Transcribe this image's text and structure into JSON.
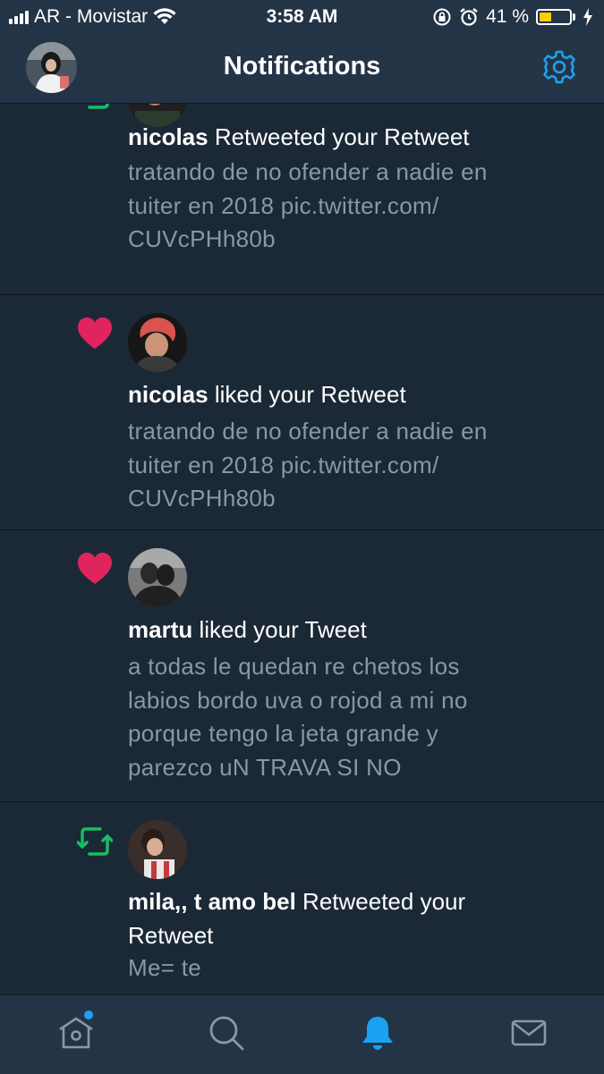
{
  "status_bar": {
    "carrier": "AR - Movistar",
    "time": "3:58 AM",
    "battery_percent": "41 %",
    "battery_level": 0.41,
    "battery_color": "#ffcc00"
  },
  "header": {
    "title": "Notifications"
  },
  "colors": {
    "accent": "#1da1f2",
    "like": "#e0245e",
    "retweet": "#17bf63",
    "background": "#1b2836",
    "bar": "#243447",
    "secondary_text": "#8899a6"
  },
  "notifications": [
    {
      "type": "retweet",
      "icon": "retweet-icon",
      "actor": "nicolas",
      "action": " Retweeted your Retweet",
      "text_lines": [
        "tratando de no ofender a nadie en",
        "tuiter en 2018 pic.twitter.com/",
        "CUVcPHh80b"
      ]
    },
    {
      "type": "like",
      "icon": "heart-icon",
      "actor": "nicolas",
      "action": " liked your Retweet",
      "text_lines": [
        "tratando de no ofender a nadie en",
        "tuiter en 2018 pic.twitter.com/",
        "CUVcPHh80b"
      ]
    },
    {
      "type": "like",
      "icon": "heart-icon",
      "actor": "martu",
      "action": " liked your Tweet",
      "text_lines": [
        "a todas le quedan re chetos los",
        "labios bordo uva o rojod a mi no",
        "porque tengo la jeta grande y",
        "parezco uN TRAVA SI NO"
      ]
    },
    {
      "type": "retweet",
      "icon": "retweet-icon",
      "actor": "mila,, t amo bel",
      "action": " Retweeted your",
      "action_line2": "Retweet",
      "text_lines": [
        "Me= te"
      ]
    }
  ],
  "tabbar": {
    "tabs": [
      "home-tab",
      "search-tab",
      "notifications-tab",
      "messages-tab"
    ],
    "active": "notifications-tab"
  }
}
